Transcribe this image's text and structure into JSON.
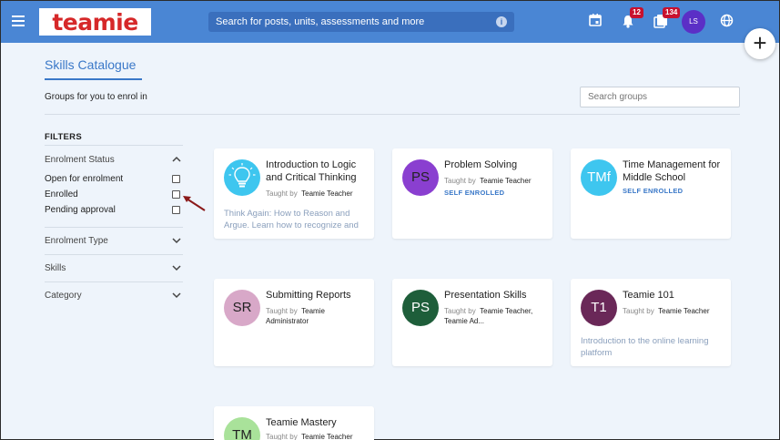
{
  "header": {
    "logo_text": "teamie",
    "search_placeholder": "Search for posts, units, assessments and more",
    "notifications_badge": "12",
    "library_badge": "134",
    "user_initials": "LS",
    "plus_label": "+"
  },
  "page": {
    "title": "Skills Catalogue",
    "subtitle": "Groups for you to enrol in",
    "search_groups_placeholder": "Search groups"
  },
  "filters": {
    "label": "FILTERS",
    "enrolment_status": {
      "heading": "Enrolment Status",
      "options": [
        "Open for enrolment",
        "Enrolled",
        "Pending approval"
      ]
    },
    "enrolment_type": "Enrolment Type",
    "skills": "Skills",
    "category": "Category"
  },
  "cards": [
    {
      "title": "Introduction to Logic and Critical Thinking",
      "taught_by": "Taught by",
      "teacher": "Teamie Teacher",
      "description": "Think Again: How to Reason and Argue. Learn how to recognize and",
      "avatar_icon": "lightbulb-icon",
      "color": "#3ec6ef"
    },
    {
      "title": "Problem Solving",
      "taught_by": "Taught by",
      "teacher": "Teamie Teacher",
      "status": "SELF ENROLLED",
      "initials": "PS",
      "color": "#8a3fd0"
    },
    {
      "title": "Time Management for Middle School",
      "status": "SELF ENROLLED",
      "initials": "TMf",
      "color": "#3ec6ef"
    },
    {
      "title": "Submitting Reports",
      "taught_by": "Taught by",
      "teacher": "Teamie Administrator",
      "initials": "SR",
      "color": "#d8a8c8"
    },
    {
      "title": "Presentation Skills",
      "taught_by": "Taught by",
      "teacher": "Teamie Teacher, Teamie Ad...",
      "initials": "PS",
      "color": "#1e5e3a"
    },
    {
      "title": "Teamie 101",
      "taught_by": "Taught by",
      "teacher": "Teamie Teacher",
      "description": "Introduction to the online learning platform",
      "initials": "T1",
      "color": "#6a2858"
    },
    {
      "title": "Teamie Mastery",
      "taught_by": "Taught by",
      "teacher": "Teamie Teacher",
      "initials": "TM",
      "color": "#a9e29a"
    }
  ]
}
